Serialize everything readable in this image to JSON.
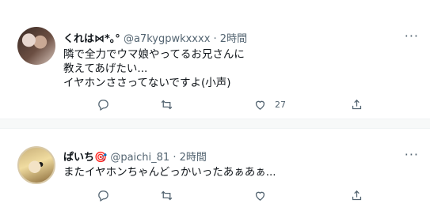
{
  "tweets": [
    {
      "name": "くれは⋈*｡°",
      "handle": "@a7kygpwkxxxx",
      "separator": " · ",
      "time": "2時間",
      "lines": [
        "隣で全力でウマ娘やってるお兄さんに",
        "教えてあげたい...",
        "イヤホンささってないですよ(小声)"
      ],
      "likes": "27"
    },
    {
      "name": "ぱいち🎯",
      "handle": "@paichi_81",
      "separator": " · ",
      "time": "2時間",
      "lines": [
        "またイヤホンちゃんどっかいったあぁあぁ..."
      ],
      "likes": ""
    }
  ],
  "more_label": "···",
  "icons": [
    "reply-icon",
    "retweet-icon",
    "like-icon",
    "share-icon",
    "more-icon"
  ],
  "colors": {
    "meta_text": "#536471",
    "divider": "#eff3f4"
  }
}
